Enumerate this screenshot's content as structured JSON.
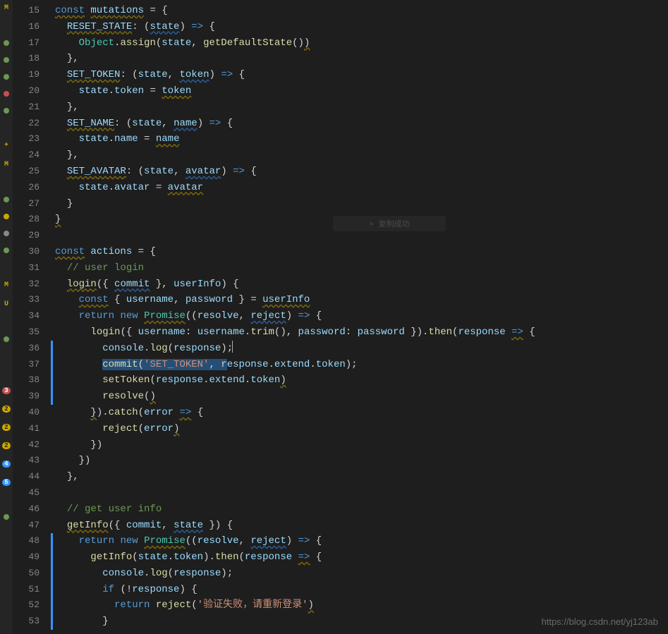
{
  "activity": {
    "items": [
      {
        "type": "letter",
        "value": "M",
        "color": "m"
      },
      {
        "type": "spacer"
      },
      {
        "type": "dot",
        "color": "green"
      },
      {
        "type": "dot",
        "color": "green"
      },
      {
        "type": "dot",
        "color": "green"
      },
      {
        "type": "dot",
        "color": "red"
      },
      {
        "type": "dot",
        "color": "green"
      },
      {
        "type": "spacer"
      },
      {
        "type": "letter",
        "value": "+",
        "color": "m"
      },
      {
        "type": "letter",
        "value": "M",
        "color": "m"
      },
      {
        "type": "spacer"
      },
      {
        "type": "dot",
        "color": "green"
      },
      {
        "type": "dot",
        "color": "orange"
      },
      {
        "type": "dot",
        "color": "gray"
      },
      {
        "type": "dot",
        "color": "green"
      },
      {
        "type": "spacer"
      },
      {
        "type": "letter",
        "value": "M",
        "color": "m"
      },
      {
        "type": "letter",
        "value": "U",
        "color": "u"
      },
      {
        "type": "spacer"
      },
      {
        "type": "dot",
        "color": "green"
      },
      {
        "type": "spacer"
      },
      {
        "type": "spacer"
      },
      {
        "type": "badge",
        "cls": "r",
        "value": "3"
      },
      {
        "type": "badge",
        "cls": "y",
        "value": "2"
      },
      {
        "type": "badge",
        "cls": "y",
        "value": "2"
      },
      {
        "type": "badge",
        "cls": "y",
        "value": "2"
      },
      {
        "type": "badge",
        "cls": "b",
        "value": "4"
      },
      {
        "type": "badge",
        "cls": "b",
        "value": "5"
      },
      {
        "type": "spacer"
      },
      {
        "type": "dot",
        "color": "green"
      }
    ]
  },
  "gutter": {
    "start": 15,
    "end": 53
  },
  "git_markers": [
    {
      "from": 36,
      "to": 39
    },
    {
      "from": 48,
      "to": 53
    }
  ],
  "toast": "× 复制成功",
  "watermark": "https://blog.csdn.net/yj123ab",
  "code_lines": [
    [
      {
        "cls": "kw wavy",
        "t": "const"
      },
      {
        "t": " "
      },
      {
        "cls": "id wavy",
        "t": "mutations"
      },
      {
        "t": " "
      },
      {
        "cls": "op",
        "t": "="
      },
      {
        "t": " "
      },
      {
        "cls": "pun",
        "t": "{"
      }
    ],
    [
      {
        "t": "  "
      },
      {
        "cls": "id wavy",
        "t": "RESET_STATE"
      },
      {
        "cls": "pun",
        "t": ":"
      },
      {
        "t": " "
      },
      {
        "cls": "pun",
        "t": "("
      },
      {
        "cls": "id wavy-b",
        "t": "state"
      },
      {
        "cls": "pun",
        "t": ")"
      },
      {
        "t": " "
      },
      {
        "cls": "kw",
        "t": "=>"
      },
      {
        "t": " "
      },
      {
        "cls": "pun",
        "t": "{"
      }
    ],
    [
      {
        "t": "    "
      },
      {
        "cls": "cls",
        "t": "Object"
      },
      {
        "cls": "pun",
        "t": "."
      },
      {
        "cls": "fn",
        "t": "assign"
      },
      {
        "cls": "pun",
        "t": "("
      },
      {
        "cls": "id",
        "t": "state"
      },
      {
        "cls": "pun",
        "t": ","
      },
      {
        "t": " "
      },
      {
        "cls": "fn",
        "t": "getDefaultState"
      },
      {
        "cls": "pun",
        "t": "("
      },
      {
        "cls": "pun",
        "t": ")"
      },
      {
        "cls": "pun wavy",
        "t": ")"
      }
    ],
    [
      {
        "t": "  "
      },
      {
        "cls": "pun",
        "t": "}"
      },
      {
        "cls": "pun",
        "t": ","
      }
    ],
    [
      {
        "t": "  "
      },
      {
        "cls": "id wavy",
        "t": "SET_TOKEN"
      },
      {
        "cls": "pun",
        "t": ":"
      },
      {
        "t": " "
      },
      {
        "cls": "pun",
        "t": "("
      },
      {
        "cls": "id",
        "t": "state"
      },
      {
        "cls": "pun",
        "t": ","
      },
      {
        "t": " "
      },
      {
        "cls": "id wavy-b",
        "t": "token"
      },
      {
        "cls": "pun",
        "t": ")"
      },
      {
        "t": " "
      },
      {
        "cls": "kw",
        "t": "=>"
      },
      {
        "t": " "
      },
      {
        "cls": "pun",
        "t": "{"
      }
    ],
    [
      {
        "t": "    "
      },
      {
        "cls": "id",
        "t": "state"
      },
      {
        "cls": "pun",
        "t": "."
      },
      {
        "cls": "id",
        "t": "token"
      },
      {
        "t": " "
      },
      {
        "cls": "op",
        "t": "="
      },
      {
        "t": " "
      },
      {
        "cls": "id wavy",
        "t": "token"
      }
    ],
    [
      {
        "t": "  "
      },
      {
        "cls": "pun",
        "t": "}"
      },
      {
        "cls": "pun",
        "t": ","
      }
    ],
    [
      {
        "t": "  "
      },
      {
        "cls": "id wavy",
        "t": "SET_NAME"
      },
      {
        "cls": "pun",
        "t": ":"
      },
      {
        "t": " "
      },
      {
        "cls": "pun",
        "t": "("
      },
      {
        "cls": "id",
        "t": "state"
      },
      {
        "cls": "pun",
        "t": ","
      },
      {
        "t": " "
      },
      {
        "cls": "id wavy-b",
        "t": "name"
      },
      {
        "cls": "pun",
        "t": ")"
      },
      {
        "t": " "
      },
      {
        "cls": "kw",
        "t": "=>"
      },
      {
        "t": " "
      },
      {
        "cls": "pun",
        "t": "{"
      }
    ],
    [
      {
        "t": "    "
      },
      {
        "cls": "id",
        "t": "state"
      },
      {
        "cls": "pun",
        "t": "."
      },
      {
        "cls": "id",
        "t": "name"
      },
      {
        "t": " "
      },
      {
        "cls": "op",
        "t": "="
      },
      {
        "t": " "
      },
      {
        "cls": "id wavy",
        "t": "name"
      }
    ],
    [
      {
        "t": "  "
      },
      {
        "cls": "pun",
        "t": "}"
      },
      {
        "cls": "pun",
        "t": ","
      }
    ],
    [
      {
        "t": "  "
      },
      {
        "cls": "id wavy",
        "t": "SET_AVATAR"
      },
      {
        "cls": "pun",
        "t": ":"
      },
      {
        "t": " "
      },
      {
        "cls": "pun",
        "t": "("
      },
      {
        "cls": "id",
        "t": "state"
      },
      {
        "cls": "pun",
        "t": ","
      },
      {
        "t": " "
      },
      {
        "cls": "id wavy-b",
        "t": "avatar"
      },
      {
        "cls": "pun",
        "t": ")"
      },
      {
        "t": " "
      },
      {
        "cls": "kw",
        "t": "=>"
      },
      {
        "t": " "
      },
      {
        "cls": "pun",
        "t": "{"
      }
    ],
    [
      {
        "t": "    "
      },
      {
        "cls": "id",
        "t": "state"
      },
      {
        "cls": "pun",
        "t": "."
      },
      {
        "cls": "id",
        "t": "avatar"
      },
      {
        "t": " "
      },
      {
        "cls": "op",
        "t": "="
      },
      {
        "t": " "
      },
      {
        "cls": "id wavy",
        "t": "avatar"
      }
    ],
    [
      {
        "t": "  "
      },
      {
        "cls": "pun",
        "t": "}"
      }
    ],
    [
      {
        "cls": "pun wavy",
        "t": "}"
      }
    ],
    [
      {
        "t": ""
      }
    ],
    [
      {
        "cls": "kw wavy",
        "t": "const"
      },
      {
        "t": " "
      },
      {
        "cls": "id",
        "t": "actions"
      },
      {
        "t": " "
      },
      {
        "cls": "op",
        "t": "="
      },
      {
        "t": " "
      },
      {
        "cls": "pun",
        "t": "{"
      }
    ],
    [
      {
        "t": "  "
      },
      {
        "cls": "cmt",
        "t": "// user login"
      }
    ],
    [
      {
        "t": "  "
      },
      {
        "cls": "fn wavy",
        "t": "login"
      },
      {
        "cls": "pun",
        "t": "("
      },
      {
        "cls": "pun",
        "t": "{"
      },
      {
        "t": " "
      },
      {
        "cls": "id wavy-b",
        "t": "commit"
      },
      {
        "t": " "
      },
      {
        "cls": "pun",
        "t": "}"
      },
      {
        "cls": "pun",
        "t": ","
      },
      {
        "t": " "
      },
      {
        "cls": "id",
        "t": "userInfo"
      },
      {
        "cls": "pun",
        "t": ")"
      },
      {
        "t": " "
      },
      {
        "cls": "pun",
        "t": "{"
      }
    ],
    [
      {
        "t": "    "
      },
      {
        "cls": "kw wavy",
        "t": "const"
      },
      {
        "t": " "
      },
      {
        "cls": "pun",
        "t": "{"
      },
      {
        "t": " "
      },
      {
        "cls": "id",
        "t": "username"
      },
      {
        "cls": "pun",
        "t": ","
      },
      {
        "t": " "
      },
      {
        "cls": "id",
        "t": "password"
      },
      {
        "t": " "
      },
      {
        "cls": "pun",
        "t": "}"
      },
      {
        "t": " "
      },
      {
        "cls": "op",
        "t": "="
      },
      {
        "t": " "
      },
      {
        "cls": "id wavy",
        "t": "userInfo"
      }
    ],
    [
      {
        "t": "    "
      },
      {
        "cls": "kw",
        "t": "return"
      },
      {
        "t": " "
      },
      {
        "cls": "kw",
        "t": "new"
      },
      {
        "t": " "
      },
      {
        "cls": "cls wavy",
        "t": "Promise"
      },
      {
        "cls": "pun",
        "t": "("
      },
      {
        "cls": "pun",
        "t": "("
      },
      {
        "cls": "id",
        "t": "resolve"
      },
      {
        "cls": "pun",
        "t": ","
      },
      {
        "t": " "
      },
      {
        "cls": "id wavy-b",
        "t": "reject"
      },
      {
        "cls": "pun",
        "t": ")"
      },
      {
        "t": " "
      },
      {
        "cls": "kw",
        "t": "=>"
      },
      {
        "t": " "
      },
      {
        "cls": "pun",
        "t": "{"
      }
    ],
    [
      {
        "t": "      "
      },
      {
        "cls": "fn",
        "t": "login"
      },
      {
        "cls": "pun",
        "t": "("
      },
      {
        "cls": "pun",
        "t": "{"
      },
      {
        "t": " "
      },
      {
        "cls": "id",
        "t": "username"
      },
      {
        "cls": "pun",
        "t": ":"
      },
      {
        "t": " "
      },
      {
        "cls": "id",
        "t": "username"
      },
      {
        "cls": "pun",
        "t": "."
      },
      {
        "cls": "fn",
        "t": "trim"
      },
      {
        "cls": "pun",
        "t": "("
      },
      {
        "cls": "pun",
        "t": ")"
      },
      {
        "cls": "pun",
        "t": ","
      },
      {
        "t": " "
      },
      {
        "cls": "id",
        "t": "password"
      },
      {
        "cls": "pun",
        "t": ":"
      },
      {
        "t": " "
      },
      {
        "cls": "id",
        "t": "password"
      },
      {
        "t": " "
      },
      {
        "cls": "pun",
        "t": "}"
      },
      {
        "cls": "pun",
        "t": ")"
      },
      {
        "cls": "pun",
        "t": "."
      },
      {
        "cls": "fn",
        "t": "then"
      },
      {
        "cls": "pun",
        "t": "("
      },
      {
        "cls": "id",
        "t": "response"
      },
      {
        "t": " "
      },
      {
        "cls": "kw wavy",
        "t": "=>"
      },
      {
        "t": " "
      },
      {
        "cls": "pun",
        "t": "{"
      }
    ],
    [
      {
        "t": "        "
      },
      {
        "cls": "id",
        "t": "console"
      },
      {
        "cls": "pun",
        "t": "."
      },
      {
        "cls": "fn",
        "t": "log"
      },
      {
        "cls": "pun",
        "t": "("
      },
      {
        "cls": "id",
        "t": "response"
      },
      {
        "cls": "pun",
        "t": ")"
      },
      {
        "cls": "pun",
        "t": ";"
      },
      {
        "cls": "cursor",
        "t": ""
      }
    ],
    [
      {
        "t": "        "
      },
      {
        "cls": "c-sel fn",
        "t": "commit"
      },
      {
        "cls": "c-sel pun",
        "t": "("
      },
      {
        "cls": "c-sel str",
        "t": "'SET_TOKEN'"
      },
      {
        "cls": "c-sel pun",
        "t": ","
      },
      {
        "cls": "c-sel",
        "t": " r"
      },
      {
        "cls": "id",
        "t": "esponse"
      },
      {
        "cls": "pun",
        "t": "."
      },
      {
        "cls": "id",
        "t": "extend"
      },
      {
        "cls": "pun",
        "t": "."
      },
      {
        "cls": "id",
        "t": "token"
      },
      {
        "cls": "pun",
        "t": ")"
      },
      {
        "cls": "pun",
        "t": ";"
      }
    ],
    [
      {
        "t": "        "
      },
      {
        "cls": "fn",
        "t": "setToken"
      },
      {
        "cls": "pun",
        "t": "("
      },
      {
        "cls": "id",
        "t": "response"
      },
      {
        "cls": "pun",
        "t": "."
      },
      {
        "cls": "id",
        "t": "extend"
      },
      {
        "cls": "pun",
        "t": "."
      },
      {
        "cls": "id",
        "t": "token"
      },
      {
        "cls": "pun wavy",
        "t": ")"
      }
    ],
    [
      {
        "t": "        "
      },
      {
        "cls": "fn",
        "t": "resolve"
      },
      {
        "cls": "pun",
        "t": "("
      },
      {
        "cls": "pun wavy",
        "t": ")"
      }
    ],
    [
      {
        "t": "      "
      },
      {
        "cls": "pun wavy",
        "t": "}"
      },
      {
        "cls": "pun",
        "t": ")"
      },
      {
        "cls": "pun",
        "t": "."
      },
      {
        "cls": "fn",
        "t": "catch"
      },
      {
        "cls": "pun",
        "t": "("
      },
      {
        "cls": "id",
        "t": "error"
      },
      {
        "t": " "
      },
      {
        "cls": "kw wavy",
        "t": "=>"
      },
      {
        "t": " "
      },
      {
        "cls": "pun",
        "t": "{"
      }
    ],
    [
      {
        "t": "        "
      },
      {
        "cls": "fn",
        "t": "reject"
      },
      {
        "cls": "pun",
        "t": "("
      },
      {
        "cls": "id",
        "t": "error"
      },
      {
        "cls": "pun wavy",
        "t": ")"
      }
    ],
    [
      {
        "t": "      "
      },
      {
        "cls": "pun",
        "t": "}"
      },
      {
        "cls": "pun",
        "t": ")"
      }
    ],
    [
      {
        "t": "    "
      },
      {
        "cls": "pun",
        "t": "}"
      },
      {
        "cls": "pun",
        "t": ")"
      }
    ],
    [
      {
        "t": "  "
      },
      {
        "cls": "pun",
        "t": "}"
      },
      {
        "cls": "pun",
        "t": ","
      }
    ],
    [
      {
        "t": ""
      }
    ],
    [
      {
        "t": "  "
      },
      {
        "cls": "cmt",
        "t": "// get user info"
      }
    ],
    [
      {
        "t": "  "
      },
      {
        "cls": "fn wavy",
        "t": "getInfo"
      },
      {
        "cls": "pun",
        "t": "("
      },
      {
        "cls": "pun",
        "t": "{"
      },
      {
        "t": " "
      },
      {
        "cls": "id",
        "t": "commit"
      },
      {
        "cls": "pun",
        "t": ","
      },
      {
        "t": " "
      },
      {
        "cls": "id wavy-b",
        "t": "state"
      },
      {
        "t": " "
      },
      {
        "cls": "pun",
        "t": "}"
      },
      {
        "cls": "pun",
        "t": ")"
      },
      {
        "t": " "
      },
      {
        "cls": "pun",
        "t": "{"
      }
    ],
    [
      {
        "t": "    "
      },
      {
        "cls": "kw",
        "t": "return"
      },
      {
        "t": " "
      },
      {
        "cls": "kw",
        "t": "new"
      },
      {
        "t": " "
      },
      {
        "cls": "cls wavy",
        "t": "Promise"
      },
      {
        "cls": "pun",
        "t": "("
      },
      {
        "cls": "pun",
        "t": "("
      },
      {
        "cls": "id",
        "t": "resolve"
      },
      {
        "cls": "pun",
        "t": ","
      },
      {
        "t": " "
      },
      {
        "cls": "id wavy-b",
        "t": "reject"
      },
      {
        "cls": "pun",
        "t": ")"
      },
      {
        "t": " "
      },
      {
        "cls": "kw",
        "t": "=>"
      },
      {
        "t": " "
      },
      {
        "cls": "pun",
        "t": "{"
      }
    ],
    [
      {
        "t": "      "
      },
      {
        "cls": "fn",
        "t": "getInfo"
      },
      {
        "cls": "pun",
        "t": "("
      },
      {
        "cls": "id",
        "t": "state"
      },
      {
        "cls": "pun",
        "t": "."
      },
      {
        "cls": "id",
        "t": "token"
      },
      {
        "cls": "pun",
        "t": ")"
      },
      {
        "cls": "pun",
        "t": "."
      },
      {
        "cls": "fn",
        "t": "then"
      },
      {
        "cls": "pun",
        "t": "("
      },
      {
        "cls": "id",
        "t": "response"
      },
      {
        "t": " "
      },
      {
        "cls": "kw wavy",
        "t": "=>"
      },
      {
        "t": " "
      },
      {
        "cls": "pun",
        "t": "{"
      }
    ],
    [
      {
        "t": "        "
      },
      {
        "cls": "id",
        "t": "console"
      },
      {
        "cls": "pun",
        "t": "."
      },
      {
        "cls": "fn",
        "t": "log"
      },
      {
        "cls": "pun",
        "t": "("
      },
      {
        "cls": "id",
        "t": "response"
      },
      {
        "cls": "pun",
        "t": ")"
      },
      {
        "cls": "pun",
        "t": ";"
      }
    ],
    [
      {
        "t": "        "
      },
      {
        "cls": "kw",
        "t": "if"
      },
      {
        "t": " "
      },
      {
        "cls": "pun",
        "t": "("
      },
      {
        "cls": "op",
        "t": "!"
      },
      {
        "cls": "id",
        "t": "response"
      },
      {
        "cls": "pun",
        "t": ")"
      },
      {
        "t": " "
      },
      {
        "cls": "pun",
        "t": "{"
      }
    ],
    [
      {
        "t": "          "
      },
      {
        "cls": "kw",
        "t": "return"
      },
      {
        "t": " "
      },
      {
        "cls": "fn",
        "t": "reject"
      },
      {
        "cls": "pun",
        "t": "("
      },
      {
        "cls": "str",
        "t": "'验证失败，请重新登录'"
      },
      {
        "cls": "pun wavy",
        "t": ")"
      }
    ],
    [
      {
        "t": "        "
      },
      {
        "cls": "pun",
        "t": "}"
      }
    ]
  ]
}
